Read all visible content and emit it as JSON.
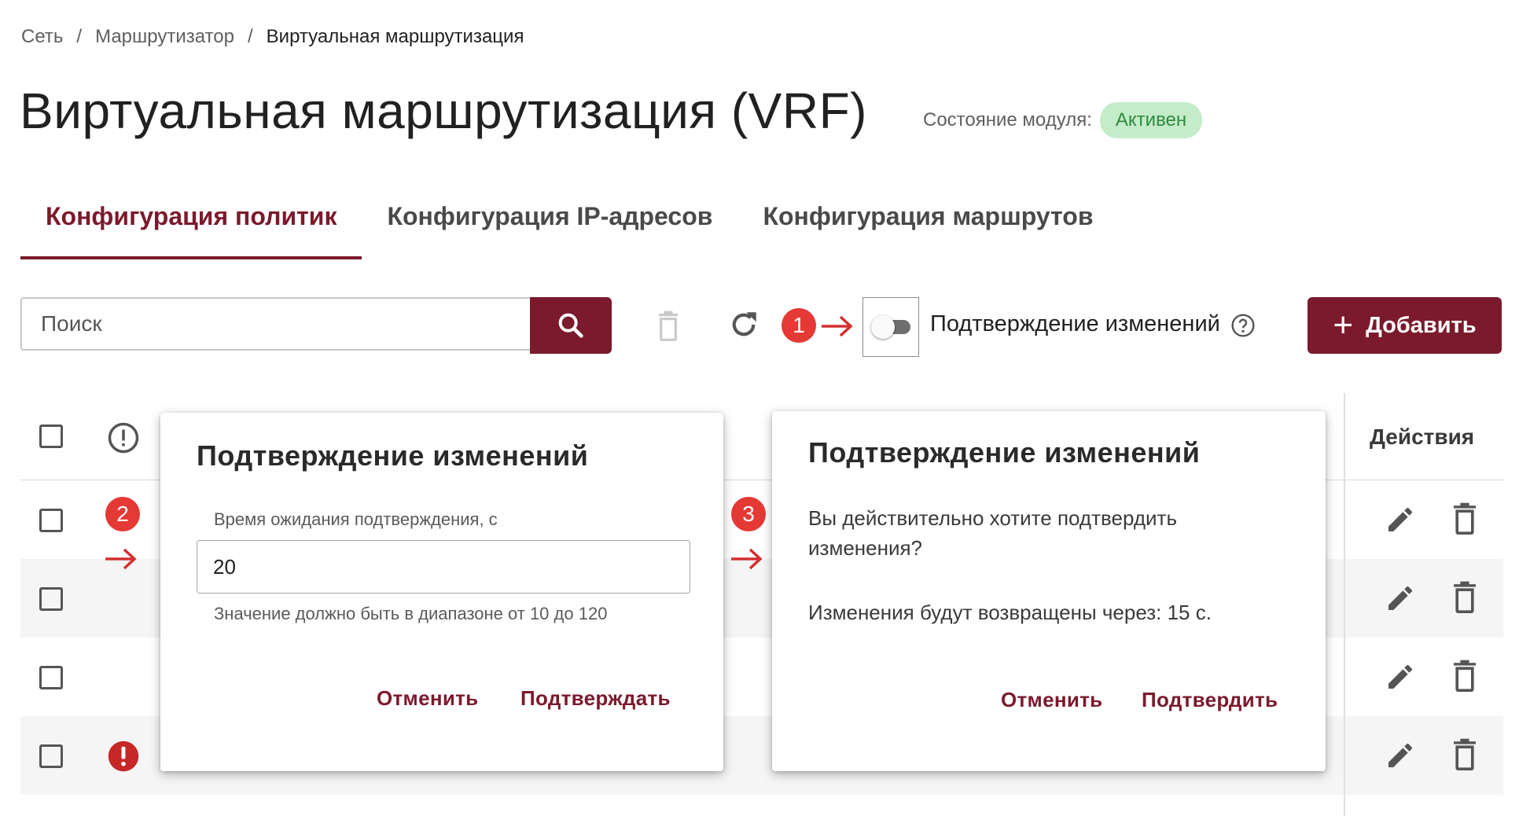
{
  "breadcrumb": [
    "Сеть",
    "Маршрутизатор",
    "Виртуальная маршрутизация"
  ],
  "breadcrumb_separator": "/",
  "page_title": "Виртуальная маршрутизация (VRF)",
  "module_state": {
    "label": "Состояние модуля:",
    "value": "Активен",
    "badge_color": "#c4ecc9",
    "text_color": "#2e8b3e"
  },
  "tabs": [
    {
      "label": "Конфигурация политик",
      "active": true
    },
    {
      "label": "Конфигурация IP-адресов",
      "active": false
    },
    {
      "label": "Конфигурация маршрутов",
      "active": false
    }
  ],
  "toolbar": {
    "search_placeholder": "Поиск",
    "confirm_toggle_label": "Подтверждение изменений",
    "confirm_toggle_on": false,
    "add_label": "Добавить",
    "icons": [
      "search-icon",
      "trash-icon",
      "refresh-icon",
      "help-icon",
      "plus-icon"
    ]
  },
  "markers": [
    "1",
    "2",
    "3"
  ],
  "table": {
    "actions_header": "Действия",
    "header_icon": "info-circle-icon",
    "row_count": 4,
    "rows": [
      {
        "status": "none"
      },
      {
        "status": "none"
      },
      {
        "status": "none"
      },
      {
        "status": "error"
      }
    ]
  },
  "dialog_timeout": {
    "title": "Подтверждение изменений",
    "field_label": "Время ожидания подтверждения, с",
    "field_value": "20",
    "hint": "Значение должно быть в диапазоне от 10 до 120",
    "cancel": "Отменить",
    "confirm": "Подтверждать"
  },
  "dialog_confirm": {
    "title": "Подтверждение изменений",
    "question": "Вы действительно хотите подтвердить изменения?",
    "countdown": "Изменения будут возвращены через: 15 с.",
    "cancel": "Отменить",
    "confirm": "Подтвердить"
  },
  "colors": {
    "accent": "#7b1a2c",
    "marker": "#e53935",
    "arrow": "#d32f2f",
    "error": "#c62828"
  }
}
